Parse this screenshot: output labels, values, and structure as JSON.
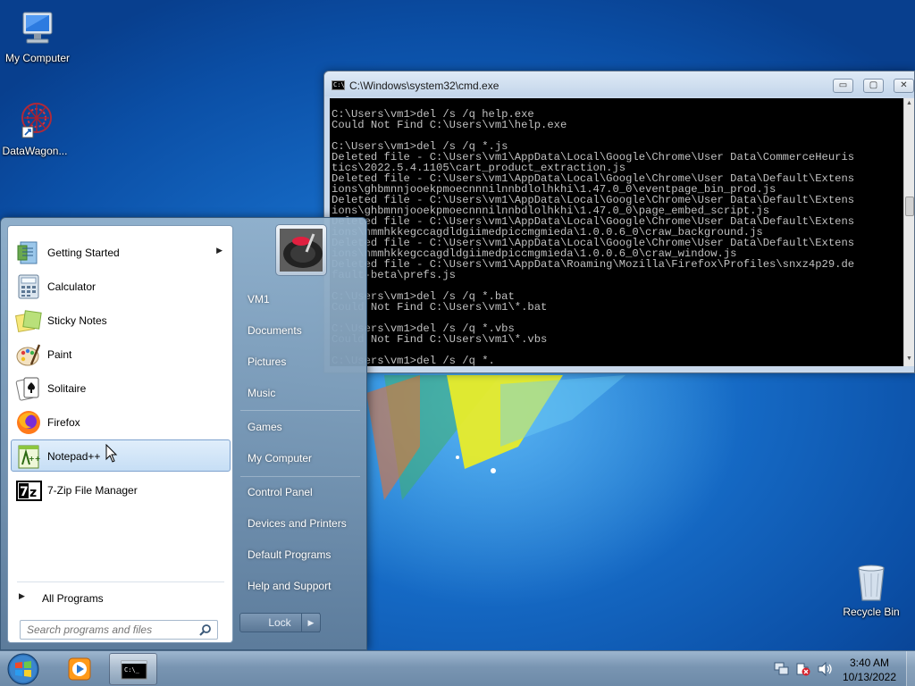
{
  "desktop": {
    "icons": [
      {
        "label": "My Computer",
        "icon": "computer-icon"
      },
      {
        "label": "DataWagon...",
        "icon": "shortcut-icon"
      },
      {
        "label": "Recycle Bin",
        "icon": "recycle-bin-icon"
      }
    ]
  },
  "cmd": {
    "title": "C:\\Windows\\system32\\cmd.exe",
    "buttons": {
      "minimize": "▭",
      "maximize": "▢",
      "close": "✕"
    },
    "lines": [
      "C:\\Users\\vm1>del /s /q help.exe",
      "Could Not Find C:\\Users\\vm1\\help.exe",
      "",
      "C:\\Users\\vm1>del /s /q *.js",
      "Deleted file - C:\\Users\\vm1\\AppData\\Local\\Google\\Chrome\\User Data\\CommerceHeuris",
      "tics\\2022.5.4.1105\\cart_product_extraction.js",
      "Deleted file - C:\\Users\\vm1\\AppData\\Local\\Google\\Chrome\\User Data\\Default\\Extens",
      "ions\\ghbmnnjooekpmoecnnnilnnbdlolhkhi\\1.47.0_0\\eventpage_bin_prod.js",
      "Deleted file - C:\\Users\\vm1\\AppData\\Local\\Google\\Chrome\\User Data\\Default\\Extens",
      "ions\\ghbmnnjooekpmoecnnnilnnbdlolhkhi\\1.47.0_0\\page_embed_script.js",
      "Deleted file - C:\\Users\\vm1\\AppData\\Local\\Google\\Chrome\\User Data\\Default\\Extens",
      "ions\\nmmhkkegccagdldgiimedpiccmgmieda\\1.0.0.6_0\\craw_background.js",
      "Deleted file - C:\\Users\\vm1\\AppData\\Local\\Google\\Chrome\\User Data\\Default\\Extens",
      "ions\\nmmhkkegccagdldgiimedpiccmgmieda\\1.0.0.6_0\\craw_window.js",
      "Deleted file - C:\\Users\\vm1\\AppData\\Roaming\\Mozilla\\Firefox\\Profiles\\snxz4p29.de",
      "fault-beta\\prefs.js",
      "",
      "C:\\Users\\vm1>del /s /q *.bat",
      "Could Not Find C:\\Users\\vm1\\*.bat",
      "",
      "C:\\Users\\vm1>del /s /q *.vbs",
      "Could Not Find C:\\Users\\vm1\\*.vbs",
      "",
      "C:\\Users\\vm1>del /s /q *."
    ]
  },
  "startmenu": {
    "programs": [
      {
        "label": "Getting Started",
        "icon": "getting-started-icon",
        "submenu": "▶"
      },
      {
        "label": "Calculator",
        "icon": "calculator-icon"
      },
      {
        "label": "Sticky Notes",
        "icon": "sticky-notes-icon"
      },
      {
        "label": "Paint",
        "icon": "paint-icon"
      },
      {
        "label": "Solitaire",
        "icon": "solitaire-icon"
      },
      {
        "label": "Firefox",
        "icon": "firefox-icon"
      },
      {
        "label": "Notepad++",
        "icon": "notepad-plus-plus-icon",
        "hovered": true
      },
      {
        "label": "7-Zip File Manager",
        "icon": "7zip-icon"
      }
    ],
    "all_programs": "All Programs",
    "all_programs_arrow": "▶",
    "search_placeholder": "Search programs and files",
    "right_links": [
      "VM1",
      "Documents",
      "Pictures",
      "Music",
      "Games",
      "My Computer",
      "Control Panel",
      "Devices and Printers",
      "Default Programs",
      "Help and Support"
    ],
    "lock_label": "Lock",
    "lock_arrow": "▶"
  },
  "taskbar": {
    "pinned": [
      {
        "name": "windows-media-player",
        "icon": "media-player-icon"
      },
      {
        "name": "cmd",
        "icon": "cmd-icon",
        "active": true
      }
    ],
    "tray": [
      "network-icon",
      "action-center-icon",
      "volume-icon"
    ],
    "time": "3:40 AM",
    "date": "10/13/2022"
  }
}
